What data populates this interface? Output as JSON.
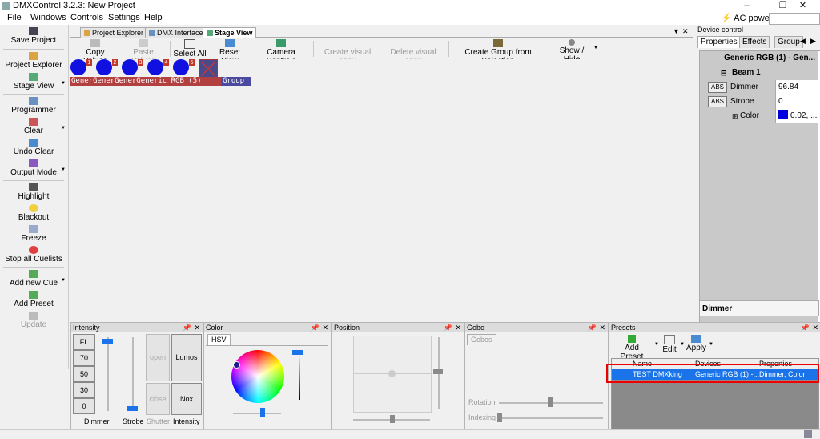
{
  "window": {
    "title": "DMXControl 3.2.3: New Project",
    "min": "–",
    "max": "❐",
    "close": "✕"
  },
  "menu": [
    "File",
    "Windows",
    "Controls",
    "Settings",
    "Help"
  ],
  "ac_power": "AC power",
  "left_bar": [
    {
      "label": "Save Project",
      "icon": "save-icon"
    },
    {
      "label": "Project Explorer",
      "icon": "folder-icon"
    },
    {
      "label": "Stage View",
      "icon": "stage-icon"
    },
    {
      "label": "Programmer",
      "icon": "programmer-icon"
    },
    {
      "label": "Clear",
      "icon": "clear-icon"
    },
    {
      "label": "Undo Clear",
      "icon": "undo-icon"
    },
    {
      "label": "Output Mode",
      "icon": "output-icon"
    },
    {
      "label": "Highlight",
      "icon": "highlight-icon"
    },
    {
      "label": "Blackout",
      "icon": "bulb-icon"
    },
    {
      "label": "Freeze",
      "icon": "freeze-icon"
    },
    {
      "label": "Stop all Cuelists",
      "icon": "stop-icon"
    },
    {
      "label": "Add new Cue",
      "icon": "add-cue-icon"
    },
    {
      "label": "Add Preset",
      "icon": "add-preset-icon"
    },
    {
      "label": "Update",
      "icon": "update-icon"
    }
  ],
  "tabs": [
    "Project Explorer",
    "DMX Interfaces",
    "Stage View"
  ],
  "toolbar": {
    "copy": "Copy Values",
    "paste": "Paste Values",
    "select_all": "Select All",
    "reset": "Reset View",
    "camera": "Camera Controls",
    "create_visual": "Create visual copy",
    "delete_visual": "Delete visual copy",
    "create_group": "Create Group from Selection",
    "show_hide": "Show / Hide"
  },
  "fixtures": [
    "1",
    "2",
    "3",
    "4",
    "5"
  ],
  "stage_label": {
    "red": "GenerGenerGenerGeneric RGB (5)",
    "blue": "Group"
  },
  "device_control": {
    "title": "Device control",
    "tabs": [
      "Properties",
      "Effects",
      "Group"
    ],
    "device": "Generic RGB (1) - Gen...",
    "beam": "Beam 1",
    "rows": [
      {
        "tag": "ABS",
        "name": "Dimmer",
        "value": "96.84"
      },
      {
        "tag": "ABS",
        "name": "Strobe",
        "value": "0"
      },
      {
        "tag": "",
        "name": "Color",
        "value": "0.02, ..."
      }
    ],
    "description": "Dimmer"
  },
  "intensity": {
    "title": "Intensity",
    "levels": [
      "FL",
      "70",
      "50",
      "30",
      "0"
    ],
    "open": "open",
    "close": "close",
    "lumos": "Lumos",
    "nox": "Nox",
    "labels": {
      "dimmer": "Dimmer",
      "strobe": "Strobe",
      "shutter": "Shutter",
      "intensity": "Intensity"
    }
  },
  "color": {
    "title": "Color",
    "tab": "HSV"
  },
  "position": {
    "title": "Position"
  },
  "gobo": {
    "title": "Gobo",
    "tab": "Gobos",
    "rotation": "Rotation",
    "indexing": "Indexing"
  },
  "presets": {
    "title": "Presets",
    "add": "Add Preset",
    "edit": "Edit",
    "apply": "Apply",
    "columns": [
      "Name",
      "Devices",
      "Properties"
    ],
    "row": {
      "name": "TEST DMXking",
      "devices": "Generic RGB (1) -...",
      "properties": "Dimmer, Color"
    }
  },
  "colors": {
    "accent": "#1a73e8",
    "fixture": "#1010e0",
    "highlight": "#e00000"
  }
}
